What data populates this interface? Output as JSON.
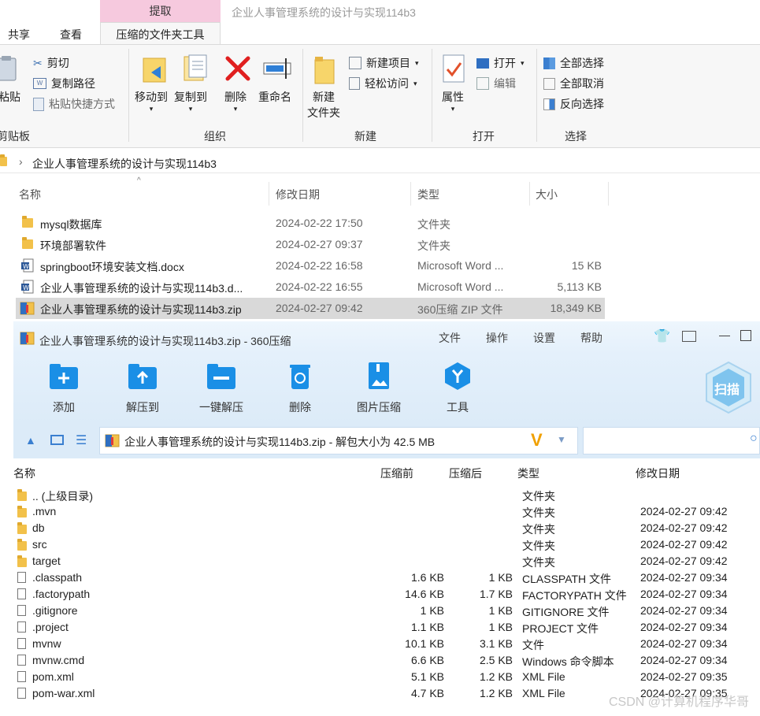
{
  "window": {
    "title": "企业人事管理系统的设计与实现114b3",
    "context_tab": "提取"
  },
  "ribbon": {
    "tabs": [
      "共享",
      "查看",
      "压缩的文件夹工具"
    ],
    "clipboard": {
      "paste_partial": "粘贴",
      "cut": "剪切",
      "copy_path": "复制路径",
      "paste_shortcut": "粘贴快捷方式",
      "label": "剪贴板"
    },
    "organize": {
      "move_to": "移动到",
      "copy_to": "复制到",
      "delete": "删除",
      "rename": "重命名",
      "label": "组织"
    },
    "new": {
      "new_folder": "新建\n文件夹",
      "new_item": "新建项目",
      "easy_access": "轻松访问",
      "label": "新建"
    },
    "open": {
      "properties": "属性",
      "open": "打开",
      "edit": "编辑",
      "label": "打开"
    },
    "select": {
      "select_all": "全部选择",
      "select_none": "全部取消",
      "invert": "反向选择",
      "label": "选择"
    }
  },
  "address": {
    "path": "企业人事管理系统的设计与实现114b3"
  },
  "explorer": {
    "columns": [
      "名称",
      "修改日期",
      "类型",
      "大小"
    ],
    "rows": [
      {
        "name": "mysql数据库",
        "date": "2024-02-22 17:50",
        "type": "文件夹",
        "size": "",
        "icon": "folder-icon"
      },
      {
        "name": "环境部署软件",
        "date": "2024-02-27 09:37",
        "type": "文件夹",
        "size": "",
        "icon": "folder-icon"
      },
      {
        "name": "springboot环境安装文档.docx",
        "date": "2024-02-22 16:58",
        "type": "Microsoft Word ...",
        "size": "15 KB",
        "icon": "word-doc-icon"
      },
      {
        "name": "企业人事管理系统的设计与实现114b3.d...",
        "date": "2024-02-22 16:55",
        "type": "Microsoft Word ...",
        "size": "5,113 KB",
        "icon": "word-doc-icon"
      },
      {
        "name": "企业人事管理系统的设计与实现114b3.zip",
        "date": "2024-02-27 09:42",
        "type": "360压缩 ZIP 文件",
        "size": "18,349 KB",
        "icon": "zip-icon",
        "selected": true
      }
    ]
  },
  "zip": {
    "title": "企业人事管理系统的设计与实现114b3.zip - 360压缩",
    "menu": [
      "文件",
      "操作",
      "设置",
      "帮助"
    ],
    "tools": [
      "添加",
      "解压到",
      "一键解压",
      "删除",
      "图片压缩",
      "工具"
    ],
    "scan": "扫描",
    "path": "企业人事管理系统的设计与实现114b3.zip - 解包大小为 42.5 MB",
    "columns": [
      "名称",
      "压缩前",
      "压缩后",
      "类型",
      "修改日期"
    ],
    "rows": [
      {
        "name": ".. (上级目录)",
        "before": "",
        "after": "",
        "type": "文件夹",
        "date": "",
        "icon": "folder"
      },
      {
        "name": ".mvn",
        "before": "",
        "after": "",
        "type": "文件夹",
        "date": "2024-02-27 09:42",
        "icon": "folder"
      },
      {
        "name": "db",
        "before": "",
        "after": "",
        "type": "文件夹",
        "date": "2024-02-27 09:42",
        "icon": "folder"
      },
      {
        "name": "src",
        "before": "",
        "after": "",
        "type": "文件夹",
        "date": "2024-02-27 09:42",
        "icon": "folder"
      },
      {
        "name": "target",
        "before": "",
        "after": "",
        "type": "文件夹",
        "date": "2024-02-27 09:42",
        "icon": "folder"
      },
      {
        "name": ".classpath",
        "before": "1.6 KB",
        "after": "1 KB",
        "type": "CLASSPATH 文件",
        "date": "2024-02-27 09:34",
        "icon": "file"
      },
      {
        "name": ".factorypath",
        "before": "14.6 KB",
        "after": "1.7 KB",
        "type": "FACTORYPATH 文件",
        "date": "2024-02-27 09:34",
        "icon": "file"
      },
      {
        "name": ".gitignore",
        "before": "1 KB",
        "after": "1 KB",
        "type": "GITIGNORE 文件",
        "date": "2024-02-27 09:34",
        "icon": "file"
      },
      {
        "name": ".project",
        "before": "1.1 KB",
        "after": "1 KB",
        "type": "PROJECT 文件",
        "date": "2024-02-27 09:34",
        "icon": "file"
      },
      {
        "name": "mvnw",
        "before": "10.1 KB",
        "after": "3.1 KB",
        "type": "文件",
        "date": "2024-02-27 09:34",
        "icon": "file"
      },
      {
        "name": "mvnw.cmd",
        "before": "6.6 KB",
        "after": "2.5 KB",
        "type": "Windows 命令脚本",
        "date": "2024-02-27 09:34",
        "icon": "file"
      },
      {
        "name": "pom.xml",
        "before": "5.1 KB",
        "after": "1.2 KB",
        "type": "XML File",
        "date": "2024-02-27 09:35",
        "icon": "file"
      },
      {
        "name": "pom-war.xml",
        "before": "4.7 KB",
        "after": "1.2 KB",
        "type": "XML File",
        "date": "2024-02-27 09:35",
        "icon": "file"
      }
    ]
  },
  "watermark": "CSDN @计算机程序华哥"
}
